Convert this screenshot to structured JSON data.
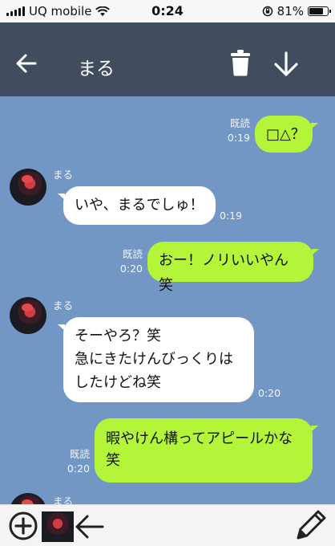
{
  "status_bar": {
    "carrier": "UQ mobile",
    "time": "0:24",
    "battery": "81%",
    "battery_level": 0.81
  },
  "header": {
    "title": "まる",
    "back_icon": "back-arrow-icon",
    "delete_icon": "trash-icon",
    "save_icon": "down-arrow-icon"
  },
  "messages": [
    {
      "side": "me",
      "text": "□△？",
      "read": "既読",
      "time": "0:19"
    },
    {
      "side": "them",
      "name": "まる",
      "text": "いや、まるでしゅ！",
      "time": "0:19"
    },
    {
      "side": "me",
      "text": "おー！ノリいいやん笑",
      "read": "既読",
      "time": "0:20"
    },
    {
      "side": "them",
      "name": "まる",
      "lines": [
        "そーやろ？笑",
        "急にきたけんびっくりは",
        "したけどね笑"
      ],
      "time": "0:20"
    },
    {
      "side": "me",
      "lines": [
        "暇やけん構ってアピールかな",
        "笑"
      ],
      "read": "既読",
      "time": "0:20"
    },
    {
      "side": "them",
      "name": "まる"
    }
  ],
  "bottom_bar": {
    "add_icon": "add-circle-icon",
    "avatar_selector": "avatar",
    "back_icon": "left-arrow-icon",
    "edit_icon": "pencil-icon"
  }
}
